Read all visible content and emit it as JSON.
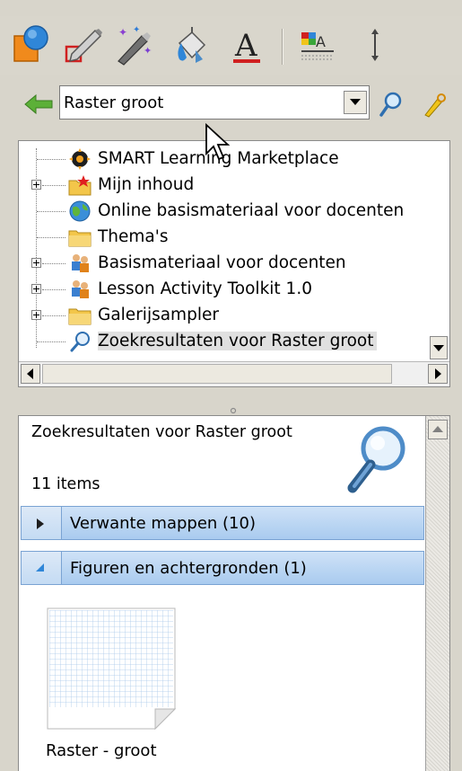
{
  "toolbar": {
    "tools": [
      {
        "icon": "shapes-icon"
      },
      {
        "icon": "pencil-icon"
      },
      {
        "icon": "magic-pen-icon"
      },
      {
        "icon": "fill-bucket-icon"
      },
      {
        "icon": "text-icon"
      },
      {
        "icon": "table-icon"
      },
      {
        "icon": "resize-icon"
      }
    ]
  },
  "search": {
    "value": "Raster groot",
    "back_icon": "back-arrow-icon",
    "search_icon": "search-icon",
    "advanced_icon": "advanced-search-icon"
  },
  "tree": {
    "items": [
      {
        "label": "SMART Learning Marketplace",
        "icon": "marketplace-icon",
        "expandable": false
      },
      {
        "label": "Mijn inhoud",
        "icon": "my-content-folder-icon",
        "expandable": true
      },
      {
        "label": "Online basismateriaal voor docenten",
        "icon": "globe-icon",
        "expandable": false
      },
      {
        "label": "Thema's",
        "icon": "folder-icon",
        "expandable": false
      },
      {
        "label": "Basismateriaal voor docenten",
        "icon": "teachers-icon",
        "expandable": true
      },
      {
        "label": "Lesson Activity Toolkit 1.0",
        "icon": "teachers-icon",
        "expandable": true
      },
      {
        "label": "Galerijsampler",
        "icon": "folder-icon",
        "expandable": true
      },
      {
        "label": "Zoekresultaten voor Raster groot",
        "icon": "search-result-icon",
        "expandable": false,
        "selected": true
      }
    ]
  },
  "results": {
    "title": "Zoekresultaten voor Raster groot",
    "count": "11 items",
    "sections": [
      {
        "label": "Verwante mappen (10)",
        "expanded": false
      },
      {
        "label": "Figuren en achtergronden (1)",
        "expanded": true
      }
    ],
    "thumbnail": {
      "caption": "Raster - groot"
    }
  },
  "colors": {
    "toolbar_bg": "#d9d6cc",
    "section_header": "#b8d4f2",
    "selection": "#e0e0e0"
  }
}
